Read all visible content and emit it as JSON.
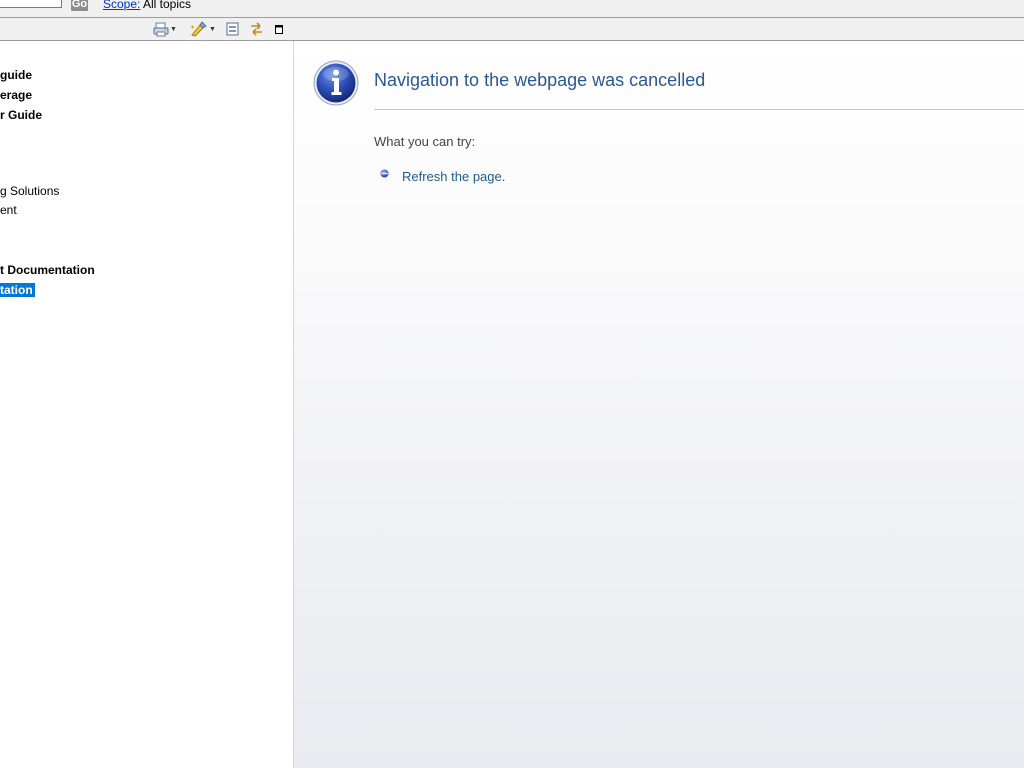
{
  "search": {
    "value": "",
    "go_label": "Go",
    "scope_label": "Scope:",
    "scope_value": "All topics"
  },
  "toolbar": {
    "icons": [
      "print-icon",
      "highlight-icon",
      "collapse-all-icon",
      "link-with-contents-icon",
      "maximize-icon"
    ]
  },
  "toc": {
    "items": [
      {
        "label": "guide",
        "bold": true,
        "selected": false
      },
      {
        "label": "erage",
        "bold": true,
        "selected": false
      },
      {
        "label": "r Guide",
        "bold": true,
        "selected": false
      },
      {
        "label": "g Solutions",
        "bold": false,
        "selected": false
      },
      {
        "label": "ent",
        "bold": false,
        "selected": false
      },
      {
        "label": "t Documentation",
        "bold": true,
        "selected": false
      },
      {
        "label": "tation",
        "bold": true,
        "selected": true
      }
    ]
  },
  "error_page": {
    "title": "Navigation to the webpage was cancelled",
    "what_you_can_try": "What you can try:",
    "refresh_link": "Refresh the page."
  },
  "colors": {
    "title": "#2b5797",
    "link": "#1e5a8f",
    "selection": "#0078d7"
  }
}
